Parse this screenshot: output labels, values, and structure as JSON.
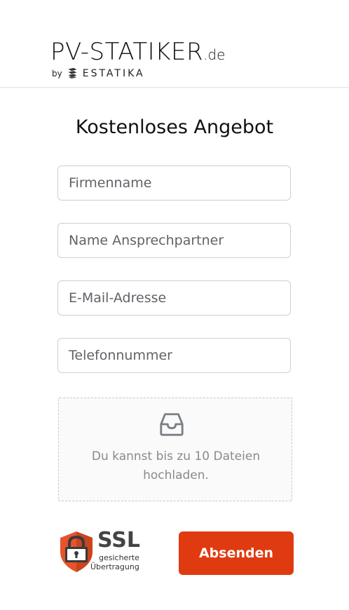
{
  "header": {
    "brand_main": "PV-STATIKER",
    "brand_tld": ".de",
    "by_label": "by",
    "estatika_label": "ESTATIKA"
  },
  "form": {
    "title": "Kostenloses Angebot",
    "fields": [
      {
        "placeholder": "Firmenname",
        "value": ""
      },
      {
        "placeholder": "Name Ansprechpartner",
        "value": ""
      },
      {
        "placeholder": "E-Mail-Adresse",
        "value": ""
      },
      {
        "placeholder": "Telefonnummer",
        "value": ""
      }
    ],
    "upload": {
      "icon": "inbox-icon",
      "line1": "Du kannst bis zu 10 Dateien",
      "line2": "hochladen."
    },
    "ssl": {
      "title": "SSL",
      "line1": "gesicherte",
      "line2": "Übertragung",
      "icon": "padlock-shield-icon"
    },
    "submit_label": "Absenden"
  },
  "colors": {
    "accent": "#e03a10",
    "shield_orange": "#e8532a",
    "shield_dark": "#3a3a3a",
    "field_border": "#cfcfd4"
  }
}
